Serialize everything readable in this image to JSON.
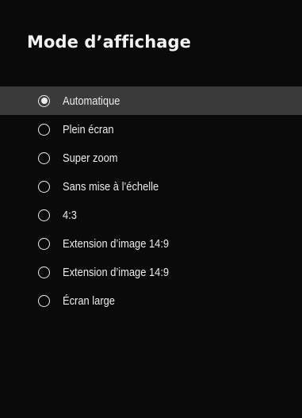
{
  "dialog": {
    "title": "Mode d’affichage",
    "selected_index": 0,
    "options": [
      {
        "label": "Automatique"
      },
      {
        "label": "Plein écran"
      },
      {
        "label": "Super zoom"
      },
      {
        "label": "Sans mise à l’échelle"
      },
      {
        "label": "4:3"
      },
      {
        "label": "Extension d’image 14:9"
      },
      {
        "label": "Extension d’image 14:9"
      },
      {
        "label": "Écran large"
      }
    ]
  },
  "colors": {
    "background": "#0a0a0a",
    "highlight": "#3a3a3a",
    "text": "#ececec"
  }
}
